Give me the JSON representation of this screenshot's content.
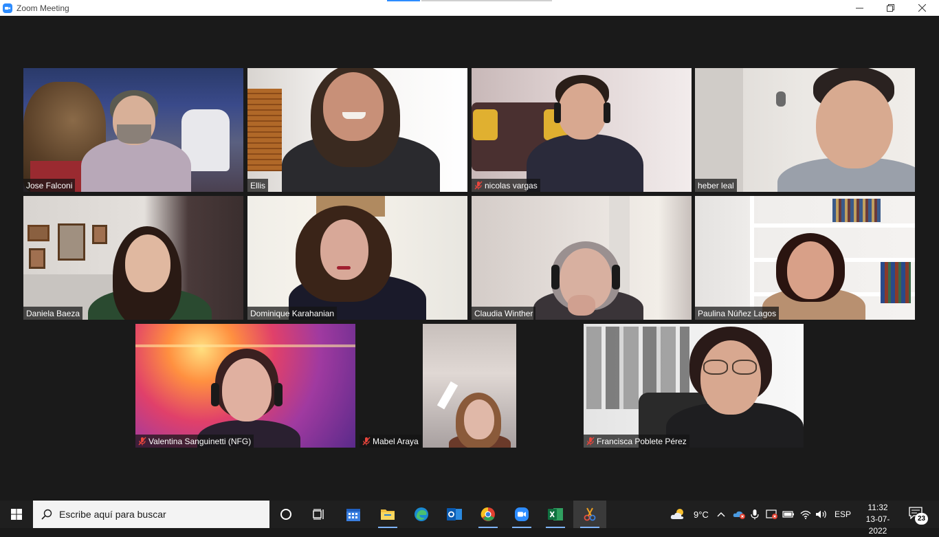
{
  "window": {
    "title": "Zoom Meeting"
  },
  "participants": [
    {
      "name": "Jose Falconi",
      "muted": false,
      "active": false
    },
    {
      "name": "Ellis",
      "muted": false,
      "active": false
    },
    {
      "name": "nicolas vargas",
      "muted": true,
      "active": false
    },
    {
      "name": "heber leal",
      "muted": false,
      "active": true
    },
    {
      "name": "Daniela Baeza",
      "muted": false,
      "active": false
    },
    {
      "name": "Dominique Karahanian",
      "muted": false,
      "active": false
    },
    {
      "name": "Claudia Winther",
      "muted": false,
      "active": false
    },
    {
      "name": "Paulina Núñez Lagos",
      "muted": false,
      "active": false
    },
    {
      "name": "Valentina Sanguinetti (NFG)",
      "muted": true,
      "active": false
    },
    {
      "name": "Mabel Araya",
      "muted": true,
      "active": false
    },
    {
      "name": "Francisca Poblete Pérez",
      "muted": true,
      "active": false
    }
  ],
  "taskbar": {
    "search_placeholder": "Escribe aquí para buscar",
    "weather": "9°C",
    "language": "ESP",
    "time": "11:32",
    "date": "13-07-2022",
    "notifications": "23"
  },
  "colors": {
    "active_speaker_border": "#c6e84a",
    "zoom_blue": "#2d8cff",
    "mute_red": "#e8453c"
  }
}
